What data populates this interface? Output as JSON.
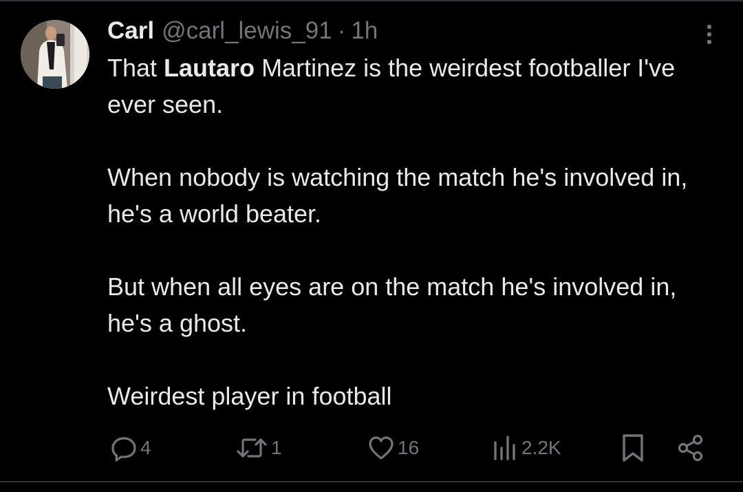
{
  "tweet": {
    "author": {
      "name": "Carl",
      "handle": "@carl_lewis_91",
      "separator": "·",
      "time": "1h"
    },
    "text": {
      "p1_before": "That ",
      "p1_mention": "Lautaro",
      "p1_after": " Martinez is the weirdest footballer I've ever seen.",
      "p2": "When nobody is watching the match he's involved in, he's a world beater.",
      "p3": "But when all eyes are on the match he's involved in, he's a ghost.",
      "p4": "Weirdest player in football"
    },
    "stats": {
      "replies": "4",
      "reposts": "1",
      "likes": "16",
      "views": "2.2K"
    }
  },
  "icons": {
    "more": "more-options-icon",
    "reply": "reply-icon",
    "repost": "repost-icon",
    "like": "heart-icon",
    "views": "analytics-icon",
    "bookmark": "bookmark-icon",
    "share": "share-icon"
  },
  "colors": {
    "background": "#000000",
    "primary_text": "#e7e9ea",
    "secondary_text": "#71767b",
    "divider": "#2f3336"
  }
}
